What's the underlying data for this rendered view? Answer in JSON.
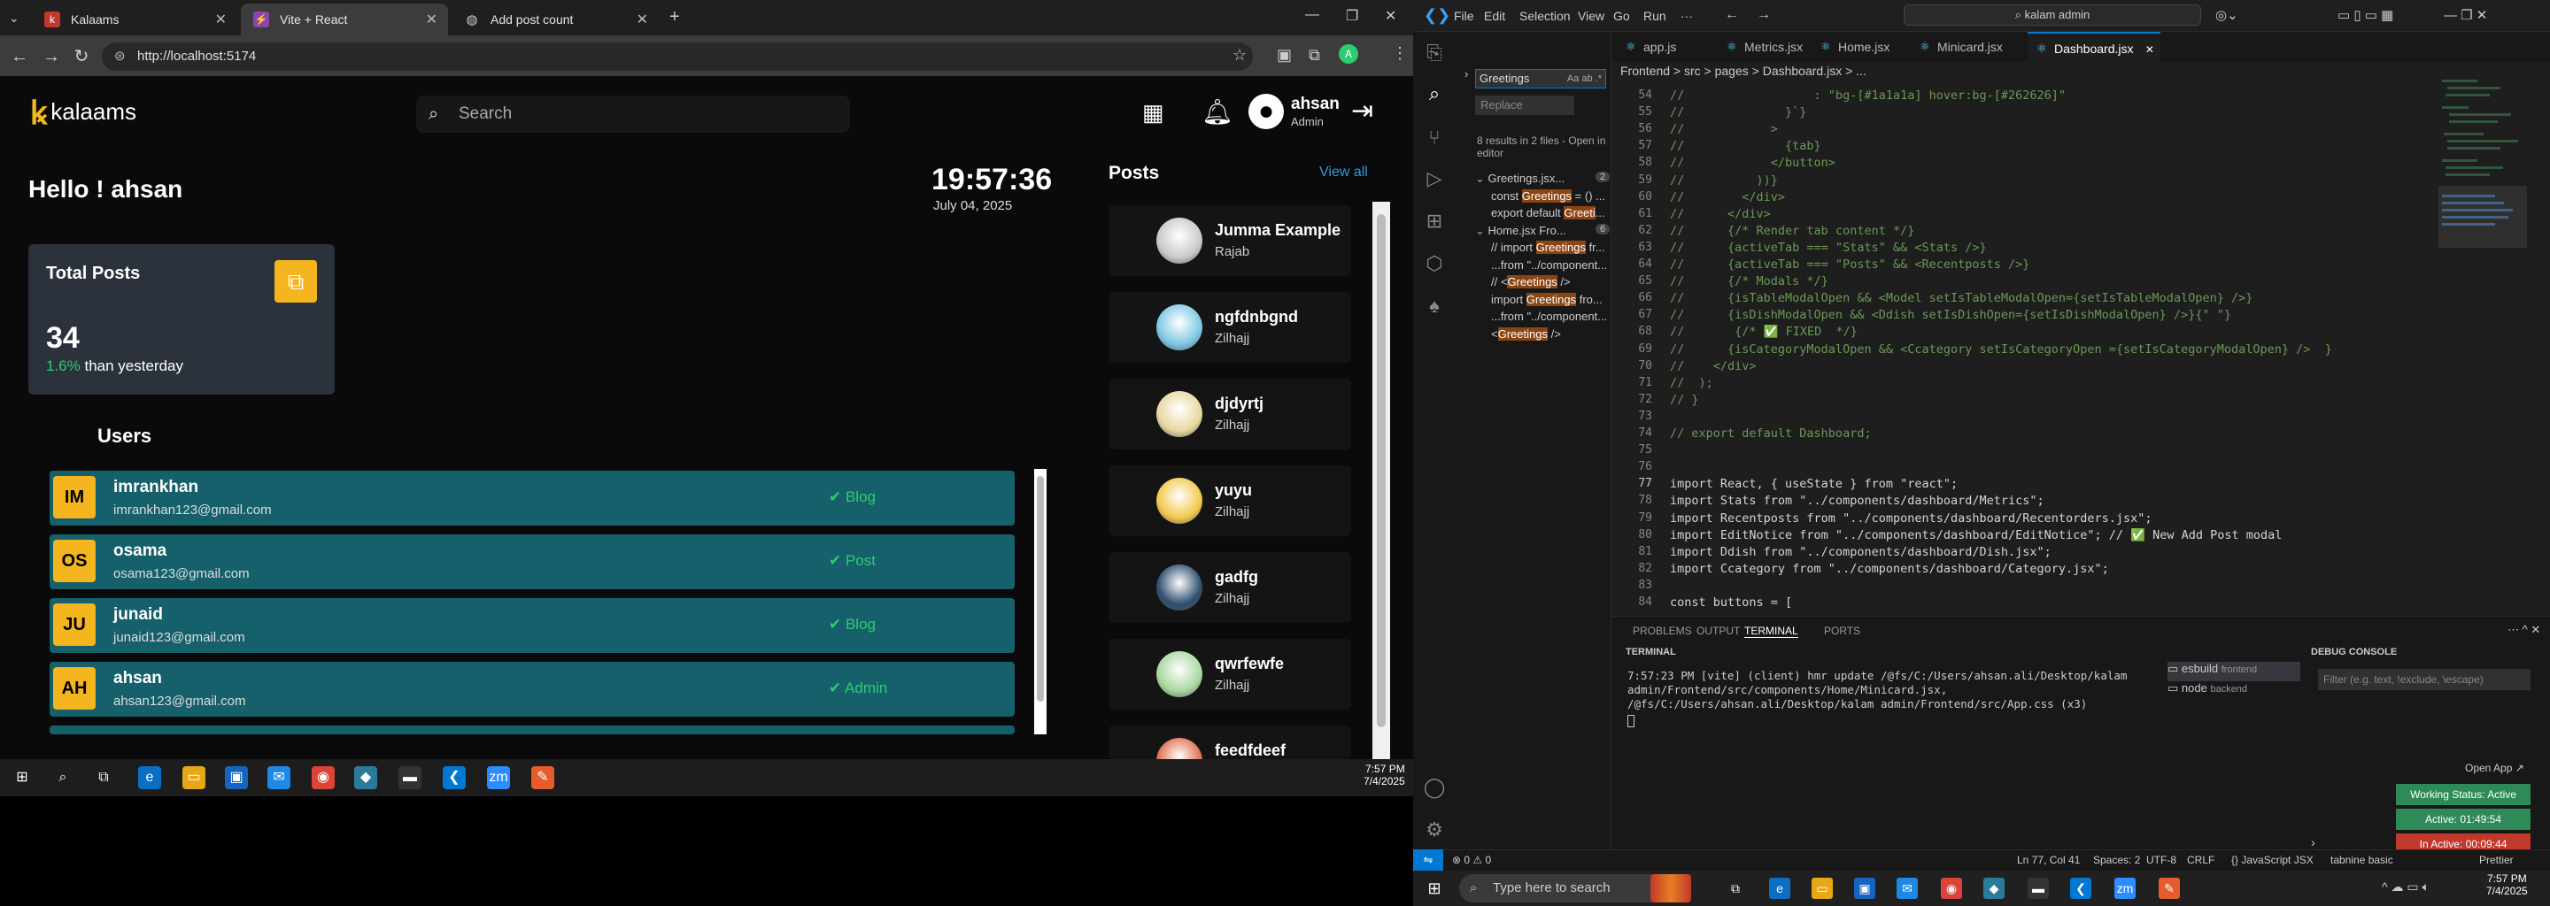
{
  "browser": {
    "tabs": [
      {
        "title": "Kalaams",
        "icon": "kalaams-favicon"
      },
      {
        "title": "Vite + React",
        "icon": "vite-favicon"
      },
      {
        "title": "Add post count",
        "icon": "globe-favicon"
      }
    ],
    "url": "http://localhost:5174"
  },
  "app": {
    "logo_text": "kalaams",
    "search_placeholder": "Search",
    "user": {
      "name": "ahsan",
      "role": "Admin"
    },
    "greeting": "Hello ! ahsan",
    "clock": "19:57:36",
    "date": "July 04, 2025",
    "total_posts": {
      "label": "Total Posts",
      "value": "34",
      "pct": "1.6%",
      "suffix": " than yesterday"
    },
    "users_heading": "Users",
    "users": [
      {
        "initials": "IM",
        "name": "imrankhan",
        "email": "imrankhan123@gmail.com",
        "role": "Blog"
      },
      {
        "initials": "OS",
        "name": "osama",
        "email": "osama123@gmail.com",
        "role": "Post"
      },
      {
        "initials": "JU",
        "name": "junaid",
        "email": "junaid123@gmail.com",
        "role": "Blog"
      },
      {
        "initials": "AH",
        "name": "ahsan",
        "email": "ahsan123@gmail.com",
        "role": "Admin"
      }
    ],
    "posts_heading": "Posts",
    "view_all": "View all",
    "posts": [
      {
        "title": "Jumma Example",
        "sub": "Rajab",
        "color": "#c9c9c9"
      },
      {
        "title": "ngfdnbgnd",
        "sub": "Zilhajj",
        "color": "#7ec8e3"
      },
      {
        "title": "djdyrtj",
        "sub": "Zilhajj",
        "color": "#e8d8a0"
      },
      {
        "title": "yuyu",
        "sub": "Zilhajj",
        "color": "#f2c94c"
      },
      {
        "title": "gadfg",
        "sub": "Zilhajj",
        "color": "#2f4f6f"
      },
      {
        "title": "qwrfewfe",
        "sub": "Zilhajj",
        "color": "#a8d8a0"
      },
      {
        "title": "feedfdeef",
        "sub": "",
        "color": "#e07050"
      }
    ]
  },
  "left_taskbar": {
    "time": "7:57 PM",
    "date": "7/4/2025"
  },
  "vscode": {
    "menu": [
      "File",
      "Edit",
      "Selection",
      "View",
      "Go",
      "Run",
      "···"
    ],
    "title_search": "kalam admin",
    "tabs": [
      "app.js",
      "Metrics.jsx",
      "Home.jsx",
      "Minicard.jsx",
      "Dashboard.jsx"
    ],
    "breadcrumb": "Frontend > src > pages > Dashboard.jsx > ...",
    "search_panel": {
      "query": "Greetings",
      "replace_placeholder": "Replace",
      "results": "8 results in 2 files - Open in editor",
      "lines": [
        {
          "text": "Greetings.jsx...",
          "hl": "",
          "badge": "2"
        },
        {
          "text": "const ",
          "hl": "Greetings",
          "tail": " = () ..."
        },
        {
          "text": "export default ",
          "hl": "Greeti",
          "tail": "..."
        },
        {
          "text": "Home.jsx Fro...",
          "hl": "",
          "badge": "6"
        },
        {
          "text": "// import ",
          "hl": "Greetings",
          "tail": " fr..."
        },
        {
          "text": "...from \"../component...",
          "hl": "",
          "tail": ""
        },
        {
          "text": "//      <",
          "hl": "Greetings",
          "tail": " />"
        },
        {
          "text": "import ",
          "hl": "Greetings",
          "tail": " fro..."
        },
        {
          "text": "...from \"../component...",
          "hl": "",
          "tail": ""
        },
        {
          "text": "<",
          "hl": "Greetings",
          "tail": " />"
        }
      ]
    },
    "code": [
      {
        "n": "54",
        "t": "//                  : \"bg-[#1a1a1a] hover:bg-[#262626]\"",
        "c": "comment"
      },
      {
        "n": "55",
        "t": "//              }`}",
        "c": "comment"
      },
      {
        "n": "56",
        "t": "//            >",
        "c": "comment"
      },
      {
        "n": "57",
        "t": "//              {tab}",
        "c": "comment"
      },
      {
        "n": "58",
        "t": "//            </button>",
        "c": "comment"
      },
      {
        "n": "59",
        "t": "//          ))}",
        "c": "comment"
      },
      {
        "n": "60",
        "t": "//        </div>",
        "c": "comment"
      },
      {
        "n": "61",
        "t": "//      </div>",
        "c": "comment"
      },
      {
        "n": "62",
        "t": "//      {/* Render tab content */}",
        "c": "comment"
      },
      {
        "n": "63",
        "t": "//      {activeTab === \"Stats\" && <Stats />}",
        "c": "comment"
      },
      {
        "n": "64",
        "t": "//      {activeTab === \"Posts\" && <Recentposts />}",
        "c": "comment"
      },
      {
        "n": "65",
        "t": "//      {/* Modals */}",
        "c": "comment"
      },
      {
        "n": "66",
        "t": "//      {isTableModalOpen && <Model setIsTableModalOpen={setIsTableModalOpen} />}",
        "c": "comment"
      },
      {
        "n": "67",
        "t": "//      {isDishModalOpen && <Ddish setIsDishOpen={setIsDishModalOpen} />}{\" \"}",
        "c": "comment"
      },
      {
        "n": "68",
        "t": "//       {/* ✅ FIXED  */}",
        "c": "comment"
      },
      {
        "n": "69",
        "t": "//      {isCategoryModalOpen && <Ccategory setIsCategoryOpen ={setIsCategoryModalOpen} />  }",
        "c": "comment"
      },
      {
        "n": "70",
        "t": "//    </div>",
        "c": "comment"
      },
      {
        "n": "71",
        "t": "//  );",
        "c": "comment"
      },
      {
        "n": "72",
        "t": "// }",
        "c": "comment"
      },
      {
        "n": "73",
        "t": "",
        "c": "code"
      },
      {
        "n": "74",
        "t": "// export default Dashboard;",
        "c": "comment"
      },
      {
        "n": "75",
        "t": "",
        "c": "code"
      },
      {
        "n": "76",
        "t": "",
        "c": "code"
      },
      {
        "n": "77",
        "t": "import React, { useState } from \"react\";",
        "c": "code"
      },
      {
        "n": "78",
        "t": "import Stats from \"../components/dashboard/Metrics\";",
        "c": "code"
      },
      {
        "n": "79",
        "t": "import Recentposts from \"../components/dashboard/Recentorders.jsx\";",
        "c": "code"
      },
      {
        "n": "80",
        "t": "import EditNotice from \"../components/dashboard/EditNotice\"; // ✅ New Add Post modal",
        "c": "code"
      },
      {
        "n": "81",
        "t": "import Ddish from \"../components/dashboard/Dish.jsx\";",
        "c": "code"
      },
      {
        "n": "82",
        "t": "import Ccategory from \"../components/dashboard/Category.jsx\";",
        "c": "code"
      },
      {
        "n": "83",
        "t": "",
        "c": "code"
      },
      {
        "n": "84",
        "t": "const buttons = [",
        "c": "code"
      }
    ],
    "panel_tabs": [
      "PROBLEMS",
      "OUTPUT",
      "TERMINAL",
      "PORTS"
    ],
    "terminal_label": "TERMINAL",
    "terminal_text": "7:57:23 PM [vite] (client) hmr update /@fs/C:/Users/ahsan.ali/Desktop/kalam admin/Frontend/src/components/Home/Minicard.jsx, /@fs/C:/Users/ahsan.ali/Desktop/kalam admin/Frontend/src/App.css (x3)",
    "terminals": [
      {
        "name": "esbuild",
        "tag": "frontend"
      },
      {
        "name": "node",
        "tag": "backend"
      }
    ],
    "debug_label": "DEBUG CONSOLE",
    "debug_filter": "Filter (e.g. text, !exclude, \\escape)",
    "open_app": "Open App ↗",
    "work_status": "Working Status: Active",
    "active_time": "Active: 01:49:54",
    "inactive_time": "In Active: 00:09:44",
    "status_left": "⊗ 0 ⚠ 0",
    "status_right": [
      "Ln 77, Col 41",
      "Spaces: 2",
      "UTF-8",
      "CRLF",
      "{} JavaScript JSX",
      "tabnine basic",
      "Prettier"
    ]
  },
  "windows_taskbar": {
    "search_placeholder": "Type here to search",
    "time": "7:57 PM",
    "date": "7/4/2025"
  }
}
